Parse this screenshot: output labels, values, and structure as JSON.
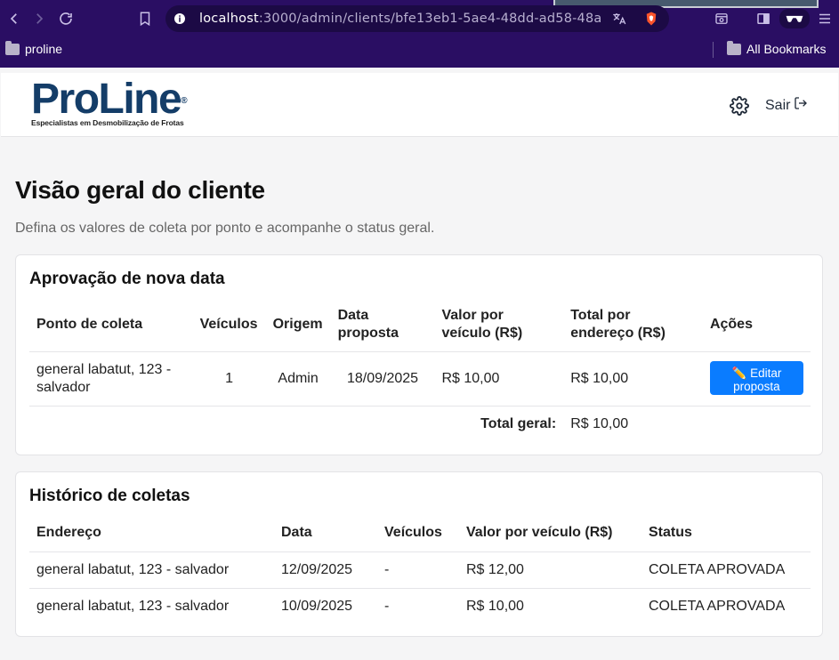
{
  "browser": {
    "url_host": "localhost",
    "url_path": ":3000/admin/clients/bfe13eb1-5ae4-48dd-ad58-48a...",
    "bookmarks": [
      {
        "label": "proline",
        "icon": "folder-icon"
      },
      {
        "label": "All Bookmarks",
        "icon": "folder-icon"
      }
    ]
  },
  "header": {
    "logo_main": "ProLine",
    "logo_reg": "®",
    "logo_tagline": "Especialistas em Desmobilização de Frotas",
    "logout_label": "Sair"
  },
  "page": {
    "title": "Visão geral do cliente",
    "subtitle": "Defina os valores de coleta por ponto e acompanhe o status geral."
  },
  "approval": {
    "title": "Aprovação de nova data",
    "columns": [
      "Ponto de coleta",
      "Veículos",
      "Origem",
      "Data proposta",
      "Valor por veículo (R$)",
      "Total por endereço (R$)",
      "Ações"
    ],
    "rows": [
      {
        "point": "general labatut, 123 - salvador",
        "vehicles": "1",
        "origin": "Admin",
        "date": "18/09/2025",
        "value_per_vehicle": "R$ 10,00",
        "total_address": "R$ 10,00",
        "action_label": "✏️ Editar proposta"
      }
    ],
    "total_label": "Total geral:",
    "total_value": "R$ 10,00"
  },
  "history": {
    "title": "Histórico de coletas",
    "columns": [
      "Endereço",
      "Data",
      "Veículos",
      "Valor por veículo (R$)",
      "Status"
    ],
    "rows": [
      {
        "address": "general labatut, 123 - salvador",
        "date": "12/09/2025",
        "vehicles": "-",
        "value": "R$ 12,00",
        "status": "COLETA APROVADA"
      },
      {
        "address": "general labatut, 123 - salvador",
        "date": "10/09/2025",
        "vehicles": "-",
        "value": "R$ 10,00",
        "status": "COLETA APROVADA"
      }
    ]
  },
  "colors": {
    "chrome_bg": "#2a0e63",
    "brand_blue": "#143d68",
    "button_blue": "#0a7cff"
  }
}
